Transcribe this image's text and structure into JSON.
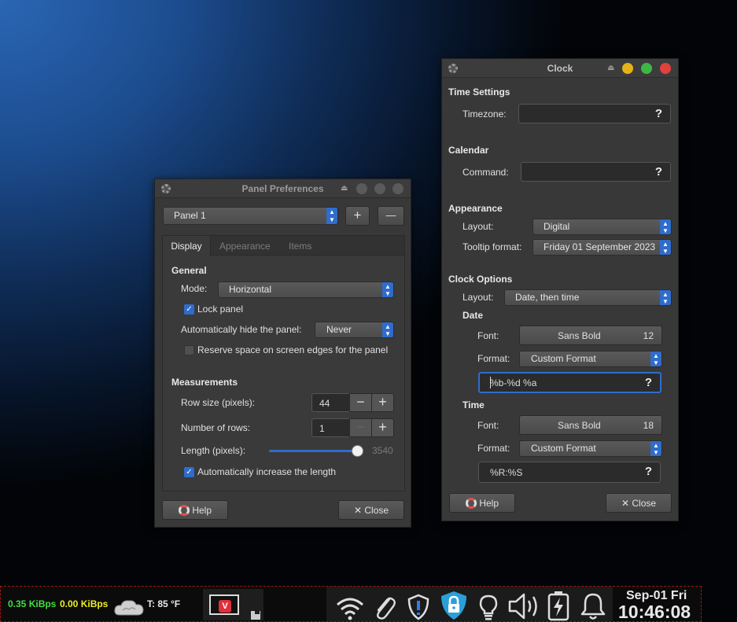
{
  "panel_prefs": {
    "title": "Panel Preferences",
    "panel_selector": "Panel 1",
    "add_symbol": "+",
    "remove_symbol": "—",
    "tabs": [
      "Display",
      "Appearance",
      "Items"
    ],
    "general": {
      "heading": "General",
      "mode_label": "Mode:",
      "mode_value": "Horizontal",
      "lock_label": "Lock panel",
      "lock_checked": true,
      "autohide_label": "Automatically hide the panel:",
      "autohide_value": "Never",
      "reserve_label": "Reserve space on screen edges for the panel",
      "reserve_checked": false
    },
    "measurements": {
      "heading": "Measurements",
      "row_size_label": "Row size (pixels):",
      "row_size_value": "44",
      "rows_label": "Number of rows:",
      "rows_value": "1",
      "length_label": "Length (pixels):",
      "length_value": "3540",
      "length_fraction": 0.97,
      "auto_increase_label": "Automatically increase the length",
      "auto_increase_checked": true
    },
    "help_label": "Help",
    "close_label": "Close"
  },
  "clock": {
    "title": "Clock",
    "time_settings": {
      "heading": "Time Settings",
      "timezone_label": "Timezone:",
      "timezone_value": ""
    },
    "calendar": {
      "heading": "Calendar",
      "command_label": "Command:",
      "command_value": ""
    },
    "appearance": {
      "heading": "Appearance",
      "layout_label": "Layout:",
      "layout_value": "Digital",
      "tooltip_label": "Tooltip format:",
      "tooltip_value": "Friday 01 September 2023"
    },
    "clock_options": {
      "heading": "Clock Options",
      "layout_label": "Layout:",
      "layout_value": "Date, then time"
    },
    "date": {
      "heading": "Date",
      "font_label": "Font:",
      "font_name": "Sans Bold",
      "font_size": "12",
      "format_label": "Format:",
      "format_value": "Custom Format",
      "custom_value": "%b-%d %a"
    },
    "time": {
      "heading": "Time",
      "font_label": "Font:",
      "font_name": "Sans Bold",
      "font_size": "18",
      "format_label": "Format:",
      "format_value": "Custom Format",
      "custom_value": "%R:%S"
    },
    "help_label": "Help",
    "close_label": "Close"
  },
  "taskbar": {
    "net_down": "0.35 KiBps",
    "net_up": "0.00 KiBps",
    "weather": "T: 85 °F",
    "date": "Sep-01 Fri",
    "time": "10:46:08",
    "colors": {
      "net_down": "#44dd44",
      "net_up": "#eeee22",
      "border": "#a01414"
    },
    "tray_icons": [
      "wifi-icon",
      "paperclip-icon",
      "shield-alert-icon",
      "security-lock-icon",
      "lightbulb-icon",
      "volume-icon",
      "battery-charging-icon",
      "bell-icon"
    ]
  },
  "colors": {
    "accent": "#2f6ccc",
    "window_bg": "#383838",
    "close_red": "#e0423e",
    "minimize_yellow": "#e6b219",
    "maximize_green": "#3db846"
  }
}
